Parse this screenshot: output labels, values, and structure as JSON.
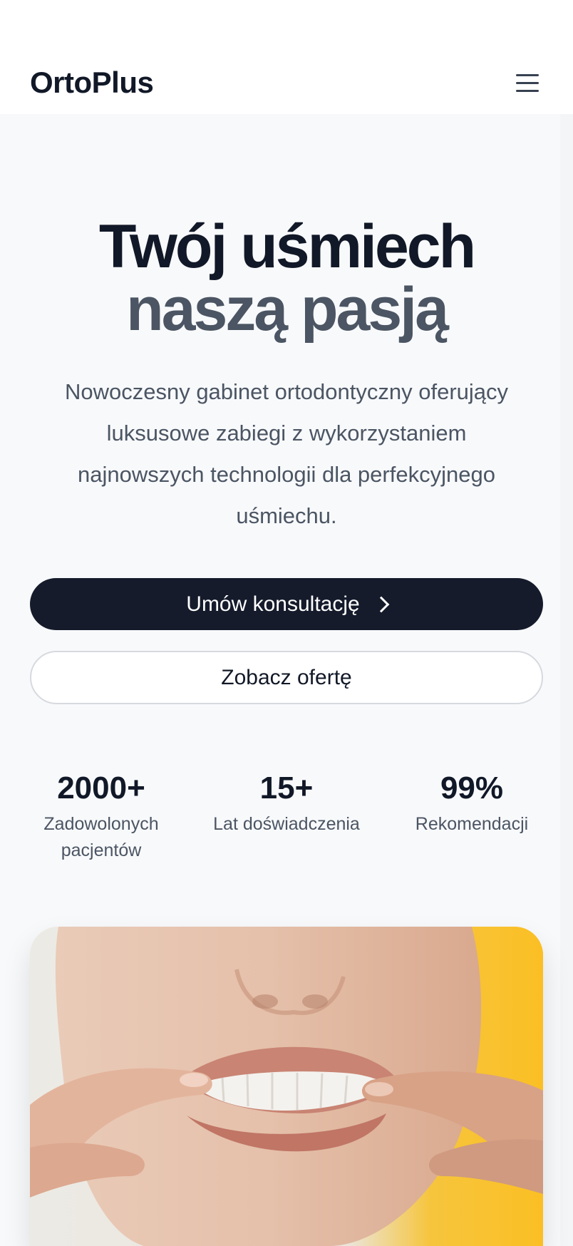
{
  "header": {
    "logo": "OrtoPlus",
    "menu_icon": "hamburger-menu-icon"
  },
  "hero": {
    "title_line1": "Twój uśmiech",
    "title_line2": "naszą pasją",
    "lead": "Nowoczesny gabinet ortodontyczny oferujący luksusowe zabiegi z wykorzystaniem najnowszych technologii dla perfekcyjnego uśmiechu.",
    "primary_button": "Umów konsultację",
    "primary_button_icon": "chevron-right-icon",
    "secondary_button": "Zobacz ofertę"
  },
  "stats": [
    {
      "value": "2000+",
      "label": "Zadowolonych pacjentów"
    },
    {
      "value": "15+",
      "label": "Lat doświadczenia"
    },
    {
      "value": "99%",
      "label": "Rekomendacji"
    }
  ],
  "colors": {
    "primary": "#151b2b",
    "accent_yellow": "#fbbf24",
    "muted_text": "#4b5563"
  }
}
